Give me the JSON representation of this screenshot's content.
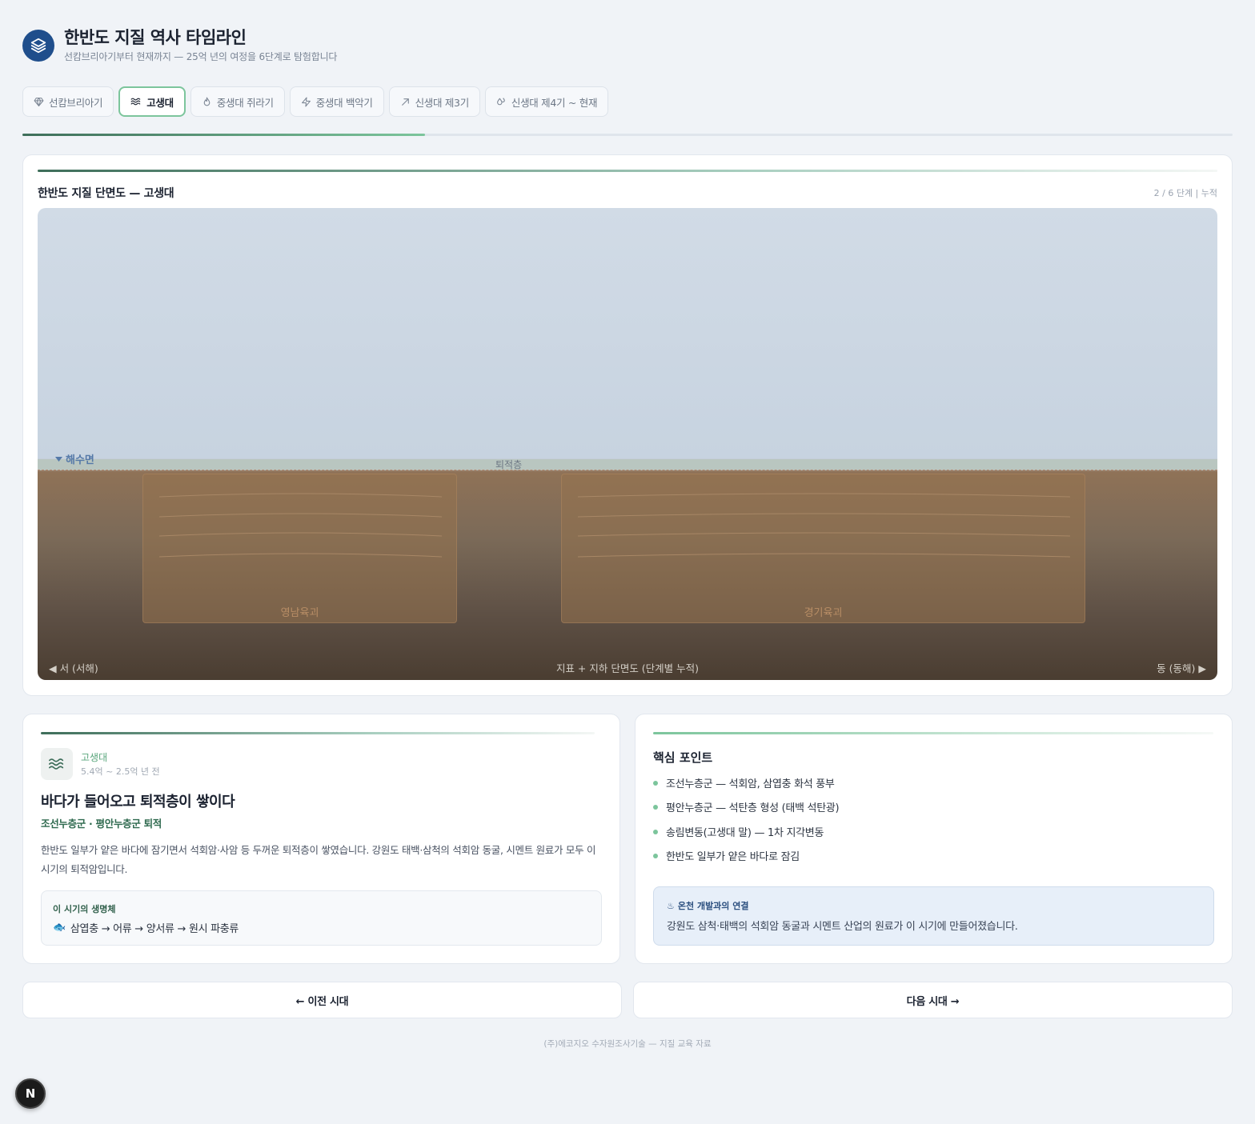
{
  "app": {
    "title": "한반도 지질 역사 타임라인",
    "subtitle": "선캄브리아기부터 현재까지 — 25억 년의 여정을 6단계로 탐험합니다"
  },
  "tabs": [
    {
      "label": "선캄브리아기",
      "icon": "gem-icon",
      "active": false
    },
    {
      "label": "고생대",
      "icon": "waves-icon",
      "active": true
    },
    {
      "label": "중생대 쥐라기",
      "icon": "flame-icon",
      "active": false
    },
    {
      "label": "중생대 백악기",
      "icon": "zap-icon",
      "active": false
    },
    {
      "label": "신생대 제3기",
      "icon": "trending-up-icon",
      "active": false
    },
    {
      "label": "신생대 제4기 ~ 현재",
      "icon": "droplets-icon",
      "active": false
    }
  ],
  "progress": {
    "fraction": 0.333
  },
  "section": {
    "title": "한반도 지질 단면도 — 고생대",
    "meta": "2 / 6 단계 | 누적",
    "sea_label": "해수면",
    "sediment_label": "퇴적층",
    "basins": [
      "영남육괴",
      "경기육괴"
    ],
    "west_label": "◀ 서 (서해)",
    "center_label": "지표 + 지하 단면도 (단계별 누적)",
    "east_label": "동 (동해) ▶"
  },
  "era": {
    "name": "고생대",
    "years": "5.4억 ~ 2.5억 년 전",
    "heading": "바다가 들어오고 퇴적층이 쌓이다",
    "subheading": "조선누층군 · 평안누층군 퇴적",
    "description": "한반도 일부가 얕은 바다에 잠기면서 석회암·사암 등 두꺼운 퇴적층이 쌓였습니다. 강원도 태백·삼척의 석회암 동굴, 시멘트 원료가 모두 이 시기의 퇴적암입니다.",
    "life_title": "이 시기의 생명체",
    "life_icon": "🐟",
    "life_text": "삼엽충 → 어류 → 양서류 → 원시 파충류"
  },
  "points": {
    "title": "핵심 포인트",
    "items": [
      "조선누층군 — 석회암, 삼엽충 화석 풍부",
      "평안누층군 — 석탄층 형성 (태백 석탄광)",
      "송림변동(고생대 말) — 1차 지각변동",
      "한반도 일부가 얕은 바다로 잠김"
    ],
    "hot_title": "온천 개발과의 연결",
    "hot_icon": "♨",
    "hot_text": "강원도 삼척·태백의 석회암 동굴과 시멘트 산업의 원료가 이 시기에 만들어졌습니다."
  },
  "nav": {
    "prev": "← 이전 시대",
    "next": "다음 시대 →"
  },
  "footer": "(주)에코지오 수자원조사기술 — 지질 교육 자료",
  "badge": "N"
}
